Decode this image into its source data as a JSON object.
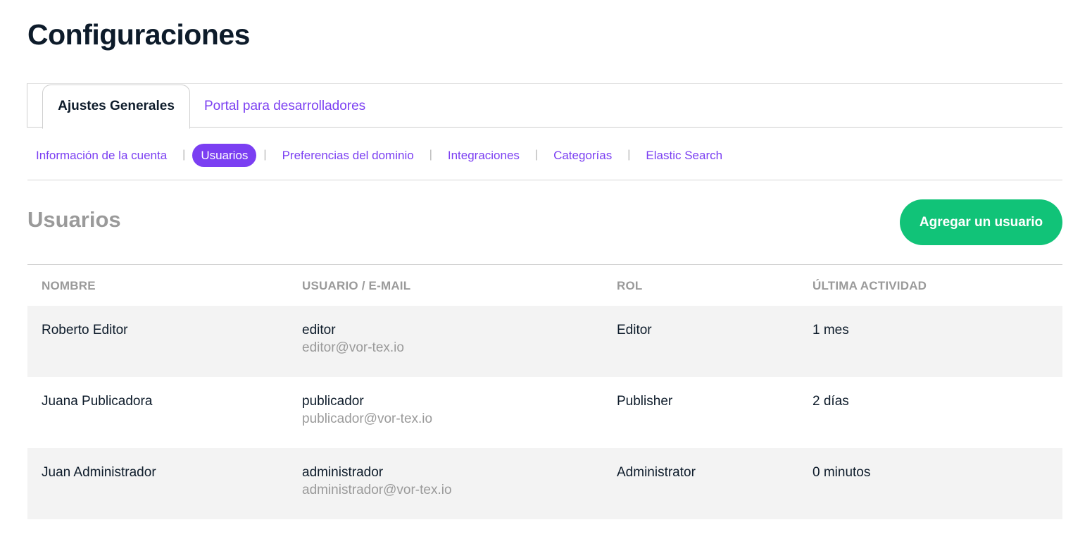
{
  "page": {
    "title": "Configuraciones"
  },
  "main_tabs": [
    {
      "label": "Ajustes Generales",
      "active": true
    },
    {
      "label": "Portal para desarrolladores",
      "active": false
    }
  ],
  "subnav": {
    "separator": "|",
    "items": [
      {
        "label": "Información de la cuenta",
        "active": false
      },
      {
        "label": "Usuarios",
        "active": true
      },
      {
        "label": "Preferencias del dominio",
        "active": false
      },
      {
        "label": "Integraciones",
        "active": false
      },
      {
        "label": "Categorías",
        "active": false
      },
      {
        "label": "Elastic Search",
        "active": false
      }
    ]
  },
  "section": {
    "title": "Usuarios",
    "add_button_label": "Agregar un usuario"
  },
  "table": {
    "headers": [
      "NOMBRE",
      "USUARIO / E-MAIL",
      "ROL",
      "ÚLTIMA ACTIVIDAD"
    ],
    "rows": [
      {
        "name": "Roberto Editor",
        "username": "editor",
        "email": "editor@vor-tex.io",
        "role": "Editor",
        "last_activity": "1 mes"
      },
      {
        "name": "Juana Publicadora",
        "username": "publicador",
        "email": "publicador@vor-tex.io",
        "role": "Publisher",
        "last_activity": "2 días"
      },
      {
        "name": "Juan Administrador",
        "username": "administrador",
        "email": "administrador@vor-tex.io",
        "role": "Administrator",
        "last_activity": "0 minutos"
      }
    ]
  },
  "colors": {
    "accent_purple": "#7b3ff2",
    "button_green": "#11c378",
    "text_dark": "#0d1b2a",
    "text_muted": "#9a9a9a",
    "row_shade": "#f3f3f3"
  }
}
